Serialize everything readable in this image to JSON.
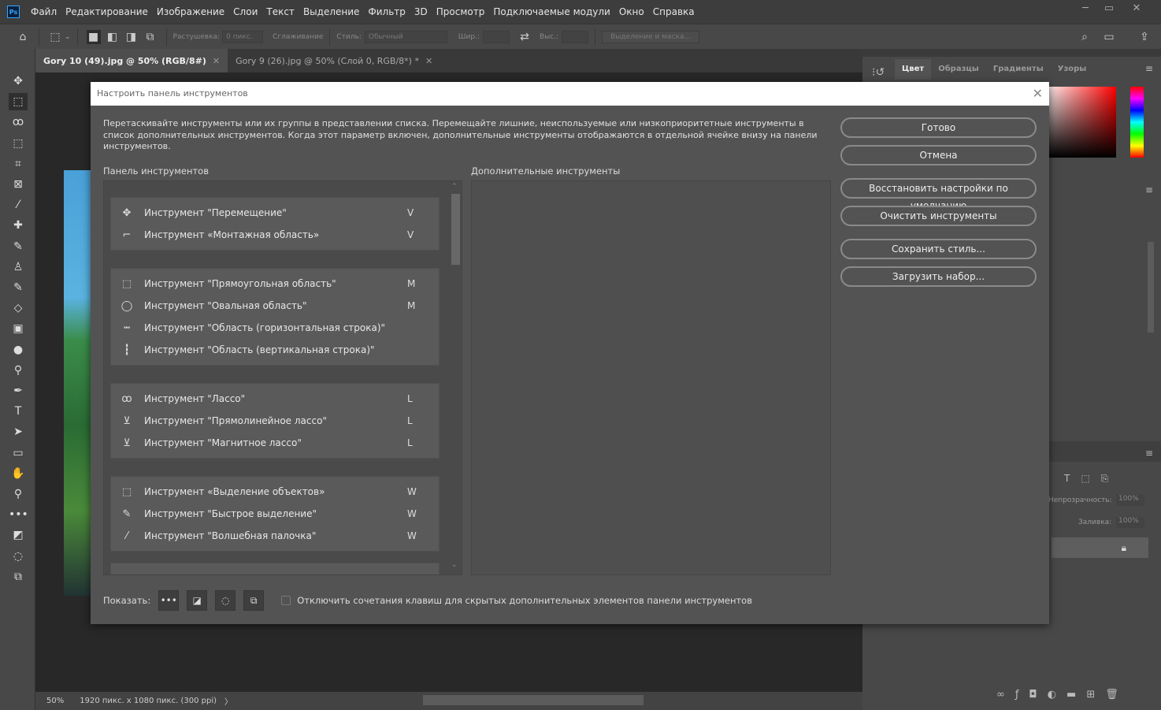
{
  "app": {
    "logo": "Ps",
    "menu": [
      "Файл",
      "Редактирование",
      "Изображение",
      "Слои",
      "Текст",
      "Выделение",
      "Фильтр",
      "3D",
      "Просмотр",
      "Подключаемые модули",
      "Окно",
      "Справка"
    ]
  },
  "options": {
    "feather_label": "Растушевка:",
    "feather_value": "0 пикс.",
    "antialias_label": "Сглаживание",
    "style_label": "Стиль:",
    "style_value": "Обычный",
    "width_label": "Шир.:",
    "height_label": "Выс.:",
    "mask_button": "Выделение и маска..."
  },
  "tabs": [
    {
      "label": "Gory 10 (49).jpg @ 50% (RGB/8#)",
      "active": true
    },
    {
      "label": "Gory 9 (26).jpg @ 50% (Слой 0, RGB/8*) *",
      "active": false
    }
  ],
  "status": {
    "zoom": "50%",
    "size": "1920 пикс. x 1080 пикс. (300 ppi)"
  },
  "right_panel": {
    "tabs": [
      "Цвет",
      "Образцы",
      "Градиенты",
      "Узоры"
    ],
    "opacity_label": "Непрозрачность:",
    "opacity_value": "100%",
    "fill_label": "Заливка:",
    "fill_value": "100%"
  },
  "dialog": {
    "title": "Настроить панель инструментов",
    "description": "Перетаскивайте инструменты или их группы в представлении списка. Перемещайте лишние, неиспользуемые или низкоприоритетные инструменты в список дополнительных инструментов. Когда этот параметр включен, дополнительные инструменты отображаются в отдельной ячейке внизу на панели инструментов.",
    "toolbar_label": "Панель инструментов",
    "extra_label": "Дополнительные инструменты",
    "groups": [
      [
        {
          "icon": "move-icon",
          "glyph": "✥",
          "name": "Инструмент \"Перемещение\"",
          "key": "V"
        },
        {
          "icon": "artboard-icon",
          "glyph": "⌐",
          "name": "Инструмент «Монтажная область»",
          "key": "V"
        }
      ],
      [
        {
          "icon": "rect-marquee-icon",
          "glyph": "⬚",
          "name": "Инструмент \"Прямоугольная область\"",
          "key": "M"
        },
        {
          "icon": "ellipse-marquee-icon",
          "glyph": "◯",
          "name": "Инструмент \"Овальная область\"",
          "key": "M"
        },
        {
          "icon": "row-marquee-icon",
          "glyph": "┅",
          "name": "Инструмент \"Область (горизонтальная строка)\"",
          "key": ""
        },
        {
          "icon": "column-marquee-icon",
          "glyph": "┇",
          "name": "Инструмент \"Область (вертикальная строка)\"",
          "key": ""
        }
      ],
      [
        {
          "icon": "lasso-icon",
          "glyph": "ꝏ",
          "name": "Инструмент \"Лассо\"",
          "key": "L"
        },
        {
          "icon": "polygonal-lasso-icon",
          "glyph": "⊻",
          "name": "Инструмент \"Прямолинейное лассо\"",
          "key": "L"
        },
        {
          "icon": "magnetic-lasso-icon",
          "glyph": "⊻",
          "name": "Инструмент \"Магнитное лассо\"",
          "key": "L"
        }
      ],
      [
        {
          "icon": "object-selection-icon",
          "glyph": "⬚",
          "name": "Инструмент «Выделение объектов»",
          "key": "W"
        },
        {
          "icon": "quick-selection-icon",
          "glyph": "✎",
          "name": "Инструмент \"Быстрое выделение\"",
          "key": "W"
        },
        {
          "icon": "magic-wand-icon",
          "glyph": "⁄",
          "name": "Инструмент \"Волшебная палочка\"",
          "key": "W"
        }
      ]
    ],
    "buttons": [
      "Готово",
      "Отмена",
      "Восстановить настройки по умолчанию",
      "Очистить инструменты",
      "Сохранить стиль...",
      "Загрузить набор..."
    ],
    "show_label": "Показать:",
    "disable_shortcuts_label": "Отключить сочетания клавиш для скрытых дополнительных элементов панели инструментов",
    "disable_shortcuts_checked": false
  }
}
